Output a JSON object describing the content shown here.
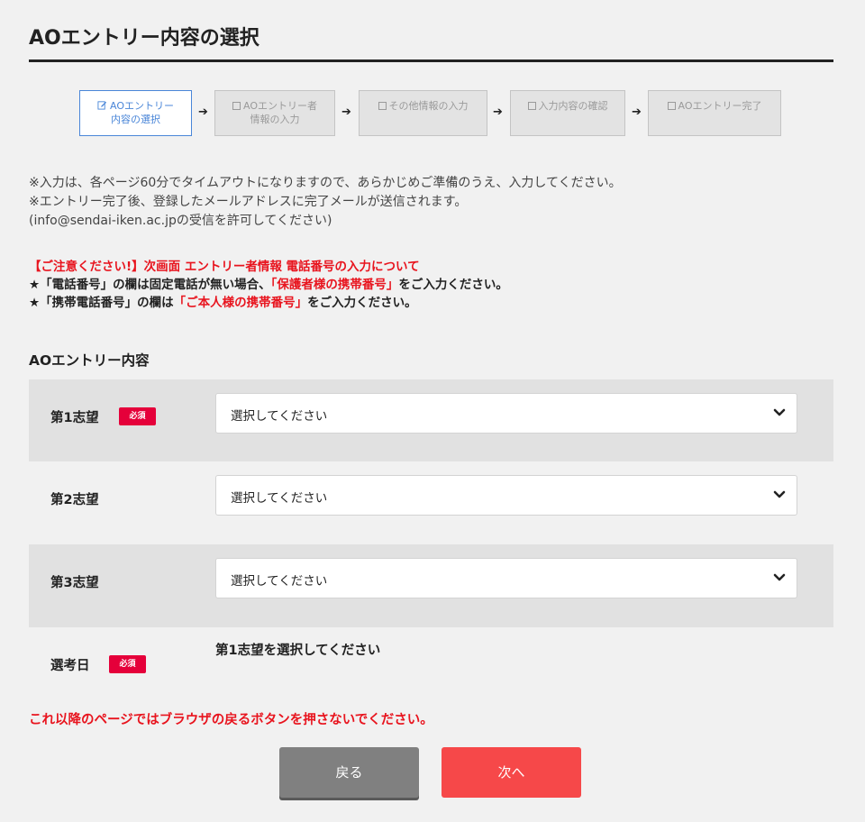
{
  "page_title": "AOエントリー内容の選択",
  "steps": [
    {
      "label": "AOエントリー\n内容の選択",
      "icon": "edit-icon",
      "active": true
    },
    {
      "label": "AOエントリー者\n情報の入力",
      "icon": "checkbox-icon",
      "active": false
    },
    {
      "label": "その他情報の入力",
      "icon": "checkbox-icon",
      "active": false
    },
    {
      "label": "入力内容の確認",
      "icon": "checkbox-icon",
      "active": false
    },
    {
      "label": "AOエントリー完了",
      "icon": "checkbox-icon",
      "active": false
    }
  ],
  "step_arrow": "➔",
  "notes": [
    "※入力は、各ページ60分でタイムアウトになりますので、あらかじめご準備のうえ、入力してください。",
    "※エントリー完了後、登録したメールアドレスに完了メールが送信されます。",
    "(info@sendai-iken.ac.jpの受信を許可してください)"
  ],
  "caution": {
    "heading": "【ご注意ください!】次画面 エントリー者情報 電話番号の入力について",
    "line1_pre": "★「電話番号」の欄は固定電話が無い場合、",
    "line1_emph": "「保護者様の携帯番号」",
    "line1_post": "をご入力ください。",
    "line2_pre": "★「携帯電話番号」の欄は",
    "line2_emph": "「ご本人様の携帯番号」",
    "line2_post": "をご入力ください。"
  },
  "section_title": "AOエントリー内容",
  "required_badge": "必須",
  "form": {
    "choice1": {
      "label": "第1志望",
      "value": "選択してください"
    },
    "choice2": {
      "label": "第2志望",
      "value": "選択してください"
    },
    "choice3": {
      "label": "第3志望",
      "value": "選択してください"
    },
    "exam_date": {
      "label": "選考日",
      "value": "第1志望を選択してください"
    }
  },
  "warning": "これ以降のページではブラウザの戻るボタンを押さないでください。",
  "buttons": {
    "back": "戻る",
    "next": "次へ"
  },
  "colors": {
    "accent_red": "#e8141e",
    "next_button": "#f64849",
    "back_button": "#808080",
    "active_step": "#4a86d8",
    "badge": "#e5003a"
  }
}
